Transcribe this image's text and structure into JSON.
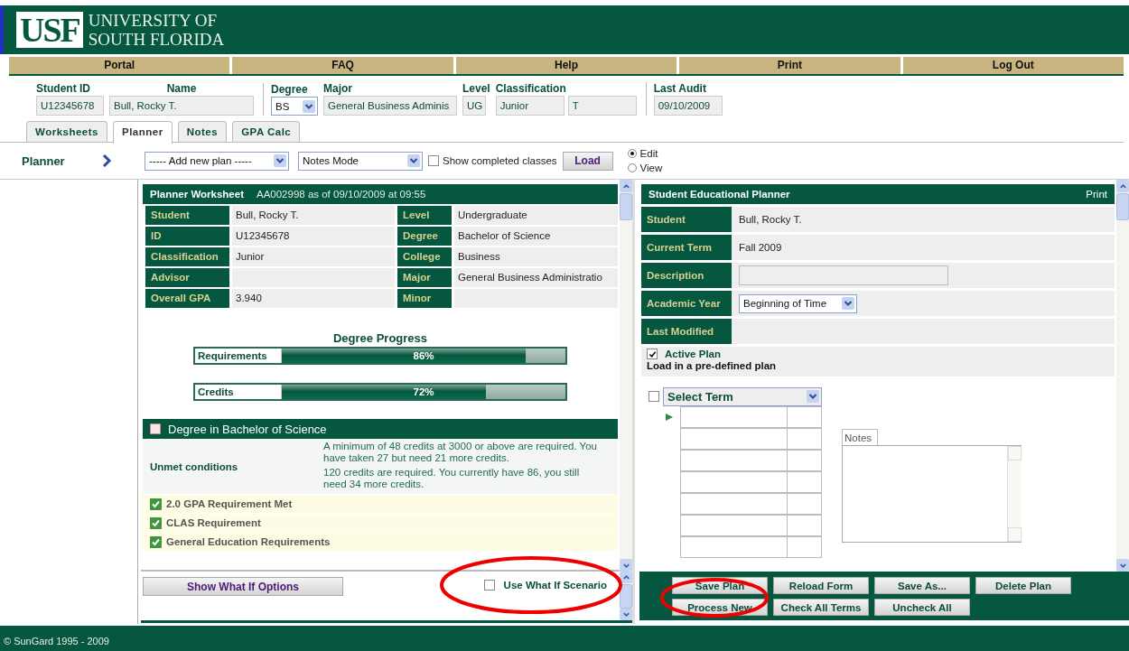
{
  "header": {
    "logo": "USF",
    "university": [
      "UNIVERSITY OF",
      "SOUTH FLORIDA"
    ]
  },
  "nav": [
    "Portal",
    "FAQ",
    "Help",
    "Print",
    "Log Out"
  ],
  "student_bar": [
    {
      "label": "Student ID",
      "fields": [
        {
          "kind": "text",
          "value": "U12345678"
        }
      ]
    },
    {
      "label": "Name",
      "fields": [
        {
          "kind": "text",
          "value": "Bull, Rocky T."
        }
      ]
    },
    {
      "label": "Degree",
      "fields": [
        {
          "kind": "select",
          "value": "BS"
        }
      ]
    },
    {
      "label": "Major",
      "fields": [
        {
          "kind": "text",
          "value": "General Business Adminis"
        }
      ]
    },
    {
      "label": "Level",
      "fields": [
        {
          "kind": "text",
          "value": "UG"
        }
      ]
    },
    {
      "label": "Classification",
      "fields": [
        {
          "kind": "text",
          "value": "Junior"
        },
        {
          "kind": "text",
          "value": "T"
        }
      ]
    },
    {
      "label": "Last Audit",
      "fields": [
        {
          "kind": "text",
          "value": "09/10/2009"
        }
      ]
    }
  ],
  "tabs": [
    {
      "label": "Worksheets",
      "selected": false
    },
    {
      "label": "Planner",
      "selected": true
    },
    {
      "label": "Notes",
      "selected": false
    },
    {
      "label": "GPA Calc",
      "selected": false
    }
  ],
  "toolbar": {
    "title": "Planner",
    "plan_select": "----- Add new plan -----",
    "mode_select": "Notes Mode",
    "show_completed": {
      "label": "Show completed classes",
      "checked": false
    },
    "load_button": "Load",
    "modes": [
      {
        "label": "Edit",
        "selected": true
      },
      {
        "label": "View",
        "selected": false
      }
    ]
  },
  "worksheet": {
    "title": "Planner Worksheet",
    "subtitle": "AA002998 as of 09/10/2009 at 09:55",
    "rows": [
      {
        "label": "Student",
        "value": "Bull, Rocky T.",
        "label_2": "Level",
        "value_2": "Undergraduate"
      },
      {
        "label": "ID",
        "value": "U12345678",
        "label_2": "Degree",
        "value_2": "Bachelor of Science"
      },
      {
        "label": "Classification",
        "value": "Junior",
        "label_2": "College",
        "value_2": "Business"
      },
      {
        "label": "Advisor",
        "label_2": "Major",
        "value_2": "General Business Administratio"
      },
      {
        "label": "Overall GPA",
        "value": "3.940",
        "label_2": "Minor"
      }
    ],
    "progress_title": "Degree Progress",
    "progress": [
      {
        "label": "Requirements",
        "level": 0.86,
        "reading": "86%"
      },
      {
        "label": "Credits",
        "level": 0.72,
        "reading": "72%"
      }
    ],
    "block": {
      "title": "Degree in Bachelor of Science",
      "checked": false,
      "unmet_label": "Unmet conditions",
      "unmet": [
        "A minimum of 48 credits at 3000 or above are required. You have taken 27 but need 21 more credits.",
        "120 credits are required. You currently have 86, you still need 34 more credits."
      ],
      "items": [
        {
          "label": "2.0 GPA Requirement Met",
          "checked": true
        },
        {
          "label": "CLAS Requirement",
          "checked": true
        },
        {
          "label": "General Education Requirements",
          "checked": true
        }
      ]
    }
  },
  "what_if": {
    "button": "Show What If Options",
    "checkbox": {
      "label": "Use What If Scenario",
      "checked": false
    }
  },
  "planner": {
    "title": "Student Educational Planner",
    "print": "Print",
    "rows": [
      {
        "label": "Student",
        "kind": "text",
        "value": "Bull, Rocky T."
      },
      {
        "label": "Current Term",
        "kind": "text",
        "value": "Fall 2009"
      },
      {
        "label": "Description",
        "kind": "input"
      },
      {
        "label": "Academic Year",
        "kind": "select",
        "value": "Beginning of Time"
      },
      {
        "label": "Last Modified",
        "kind": "text"
      }
    ],
    "active_plan": {
      "label": "Active Plan",
      "checked": true
    },
    "predefined": "Load in a pre-defined plan",
    "term": {
      "checked": false,
      "select": "Select Term"
    },
    "notes_label": "Notes"
  },
  "buttons": [
    "Save Plan",
    "Reload Form",
    "Save As...",
    "Delete Plan",
    "Process New",
    "Check All Terms",
    "Uncheck All"
  ],
  "footer": "© SunGard 1995 - 2009"
}
